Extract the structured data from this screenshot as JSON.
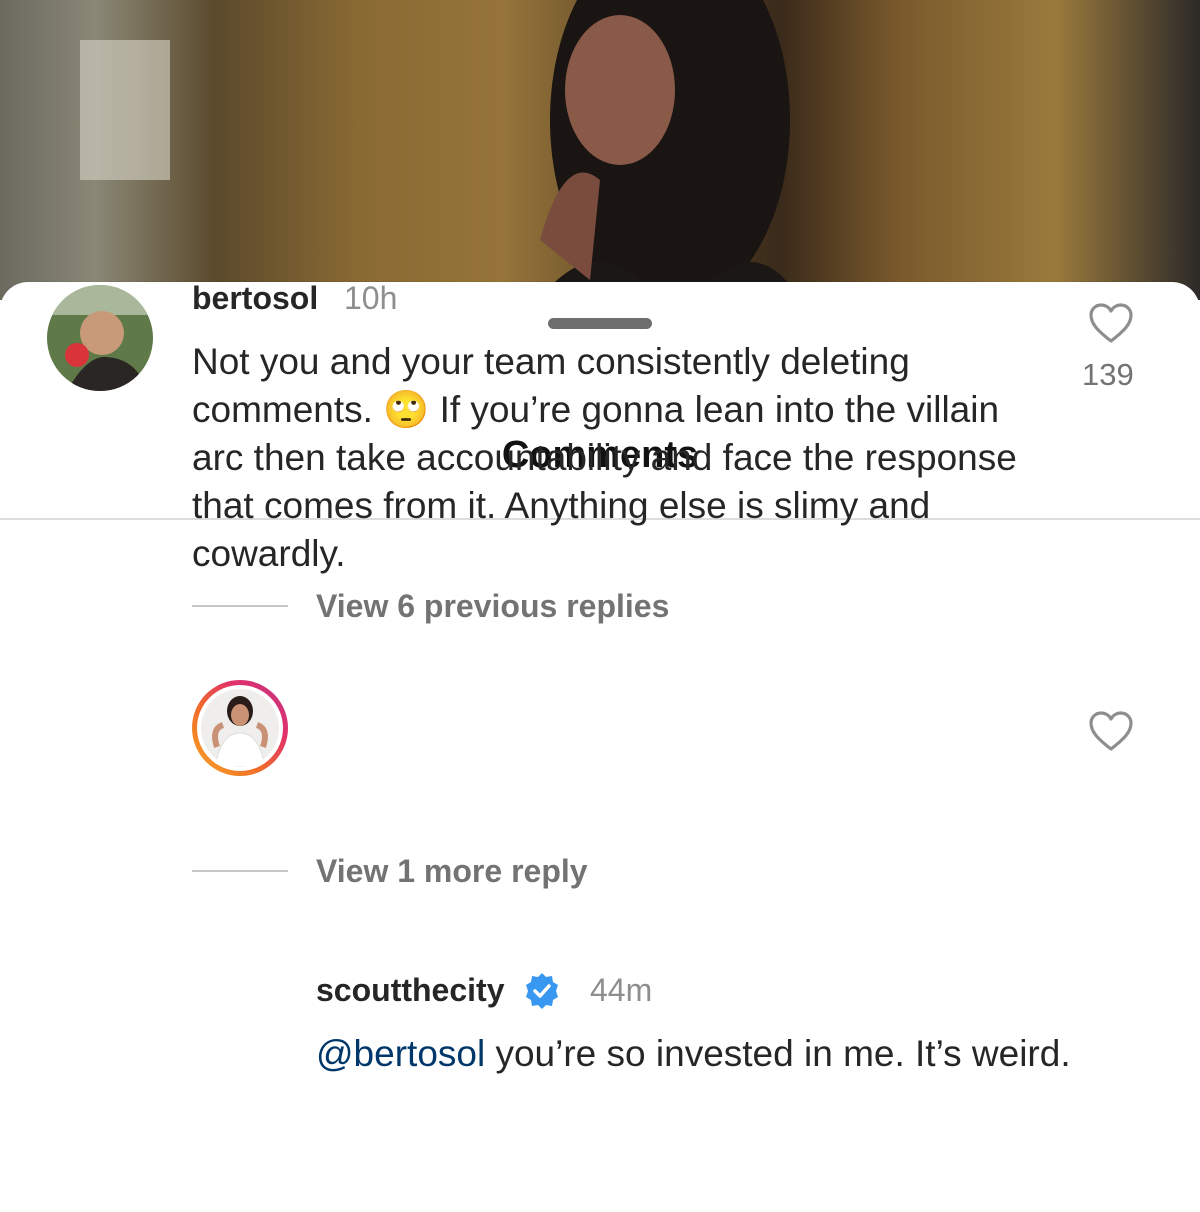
{
  "sheet": {
    "title": "Comments"
  },
  "comments": [
    {
      "username": "bertosol",
      "time": "10h",
      "text_before_emoji": "Not you and your team consistently deleting comments. ",
      "emoji": "🙄",
      "text_after_emoji": " If you’re gonna lean into the villain arc then take accountability and face the response that comes from it. Anything else is slimy and cowardly.",
      "likes": "139",
      "view_replies": "View 6 previous replies"
    },
    {
      "username": "scoutthecity",
      "verified": true,
      "time": "44m",
      "mention": "@bertosol",
      "text": " you’re so invested in me. It’s weird.",
      "view_replies": "View 1 more reply"
    }
  ],
  "colors": {
    "mention": "#00376b",
    "verified": "#3897f0",
    "story_ring_start": "#f9a825",
    "story_ring_end": "#c13584"
  },
  "icons": [
    "heart-icon",
    "verified-badge-icon"
  ]
}
